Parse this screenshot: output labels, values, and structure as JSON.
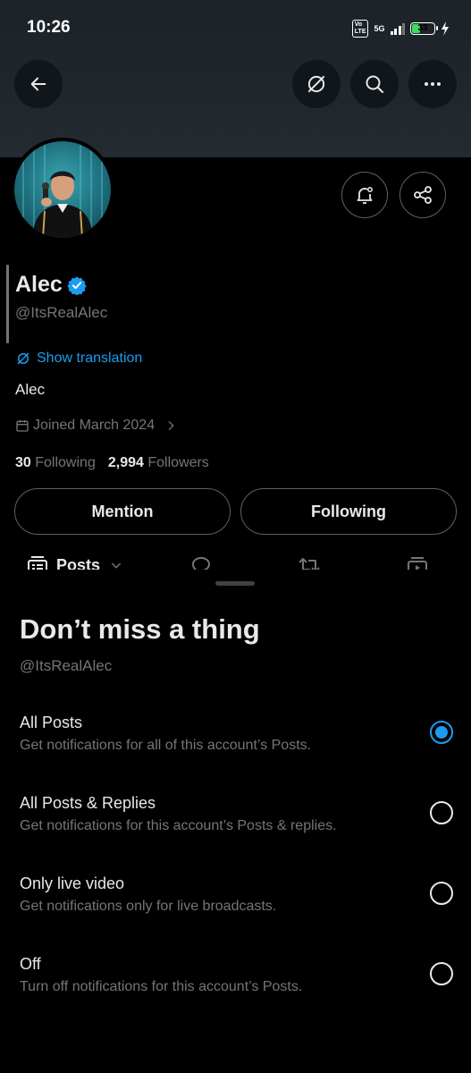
{
  "status_bar": {
    "time": "10:26",
    "volte": "VoLTE",
    "network": "5G",
    "battery": "33"
  },
  "profile": {
    "name": "Alec",
    "handle": "@ItsRealAlec",
    "translate_label": "Show translation",
    "bio": "Alec",
    "joined": "Joined March 2024",
    "following_count": "30",
    "following_label": "Following",
    "followers_count": "2,994",
    "followers_label": "Followers"
  },
  "actions": {
    "mention": "Mention",
    "following": "Following"
  },
  "tabs": {
    "posts": "Posts"
  },
  "sheet": {
    "title": "Don’t miss a thing",
    "handle": "@ItsRealAlec",
    "options": [
      {
        "title": "All Posts",
        "subtitle": "Get notifications for all of this account’s Posts.",
        "selected": true
      },
      {
        "title": "All Posts & Replies",
        "subtitle": "Get notifications for this account’s Posts & replies.",
        "selected": false
      },
      {
        "title": "Only live video",
        "subtitle": "Get notifications only for live broadcasts.",
        "selected": false
      },
      {
        "title": "Off",
        "subtitle": "Turn off notifications for this account’s Posts.",
        "selected": false
      }
    ]
  },
  "colors": {
    "accent": "#1d9bf0",
    "background": "#000000",
    "secondary_text": "#71767b",
    "banner": "#1b2228"
  },
  "icons": [
    "back-arrow-icon",
    "translate-icon",
    "search-icon",
    "more-icon",
    "bell-settings-icon",
    "share-icon",
    "verified-badge-icon",
    "calendar-icon",
    "chevron-right-icon",
    "posts-icon",
    "chevron-down-icon",
    "reply-icon",
    "retweet-icon",
    "media-icon"
  ]
}
